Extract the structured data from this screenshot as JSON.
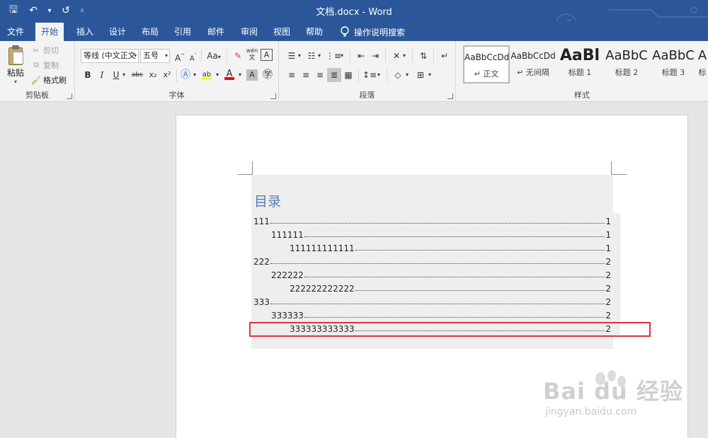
{
  "window": {
    "title": "文档.docx - Word"
  },
  "qat": {
    "save": "🖫",
    "undo": "↶",
    "undo_dd": "▾",
    "redo": "↺",
    "customize": "⩡"
  },
  "tabs": [
    {
      "label": "文件"
    },
    {
      "label": "开始"
    },
    {
      "label": "插入"
    },
    {
      "label": "设计"
    },
    {
      "label": "布局"
    },
    {
      "label": "引用"
    },
    {
      "label": "邮件"
    },
    {
      "label": "审阅"
    },
    {
      "label": "视图"
    },
    {
      "label": "帮助"
    }
  ],
  "tell_me": {
    "label": "操作说明搜索"
  },
  "clipboard": {
    "group_label": "剪贴板",
    "paste": "粘贴",
    "cut": "剪切",
    "copy": "复制",
    "format_painter": "格式刷"
  },
  "font": {
    "group_label": "字体",
    "font_name": "等线 (中文正文",
    "font_size": "五号",
    "grow": "A",
    "shrink": "A",
    "change_case": "Aa",
    "bold": "B",
    "italic": "I",
    "underline": "U",
    "strike": "abc",
    "subscript": "x₂",
    "superscript": "x²",
    "phonetic": "wén",
    "highlight_color": "#ffff00",
    "font_color": "#ff0000"
  },
  "paragraph": {
    "group_label": "段落"
  },
  "styles": {
    "group_label": "样式",
    "items": [
      {
        "sample": "AaBbCcDd",
        "name": "↵ 正文"
      },
      {
        "sample": "AaBbCcDd",
        "name": "↵ 无间隔"
      },
      {
        "sample": "AaBl",
        "name": "标题 1"
      },
      {
        "sample": "AaBbC",
        "name": "标题 2"
      },
      {
        "sample": "AaBbC",
        "name": "标题 3"
      },
      {
        "sample": "A",
        "name": "标"
      }
    ]
  },
  "document": {
    "toc_title": "目录",
    "toc_entries": [
      {
        "text": "111",
        "page": "1",
        "level": 1
      },
      {
        "text": "111111",
        "page": "1",
        "level": 2
      },
      {
        "text": "111111111111",
        "page": "1",
        "level": 3
      },
      {
        "text": "222",
        "page": "2",
        "level": 1
      },
      {
        "text": "222222",
        "page": "2",
        "level": 2
      },
      {
        "text": "222222222222",
        "page": "2",
        "level": 3
      },
      {
        "text": "333",
        "page": "2",
        "level": 1
      },
      {
        "text": "333333",
        "page": "2",
        "level": 2
      },
      {
        "text": "333333333333",
        "page": "2",
        "level": 3
      }
    ]
  },
  "watermark": {
    "brand": "Bai du 经验",
    "url": "jingyan.baidu.com"
  }
}
